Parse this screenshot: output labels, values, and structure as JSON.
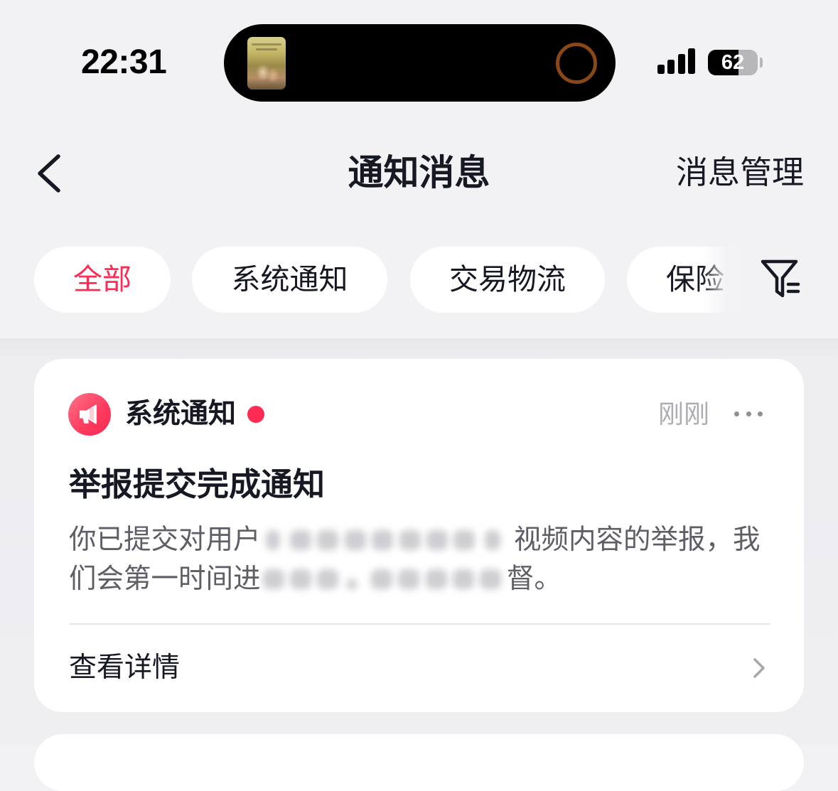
{
  "status_bar": {
    "time": "22:31",
    "battery_percent": "62",
    "battery_level": 0.62,
    "signal_level": 4,
    "signal_icon": "cellular-signal-icon",
    "battery_icon": "battery-icon"
  },
  "dynamic_island": {
    "artwork": "now-playing-artwork",
    "activity_icon": "activity-ring-icon"
  },
  "nav": {
    "back_icon": "chevron-left-icon",
    "title": "通知消息",
    "manage_label": "消息管理"
  },
  "filters": {
    "tabs": [
      {
        "label": "全部",
        "active": true
      },
      {
        "label": "系统通知",
        "active": false
      },
      {
        "label": "交易物流",
        "active": false
      },
      {
        "label": "保险",
        "active": false
      }
    ],
    "filter_icon": "filter-icon"
  },
  "notifications": [
    {
      "category_icon": "megaphone-icon",
      "category": "系统通知",
      "unread": true,
      "time": "刚刚",
      "more_icon": "more-dots-icon",
      "title": "举报提交完成通知",
      "body_lines": [
        {
          "before": "你已提交对用户",
          "after": "视频内容的举报，我"
        },
        {
          "before": "们会第一时间进",
          "after": "督。"
        }
      ],
      "action_label": "查看详情",
      "action_icon": "chevron-right-icon"
    }
  ],
  "colors": {
    "accent": "#fe2c55",
    "background": "#f2f2f4",
    "card": "#ffffff",
    "text_primary": "#161823",
    "text_body": "#5e5e66",
    "text_muted": "#acacb2"
  }
}
